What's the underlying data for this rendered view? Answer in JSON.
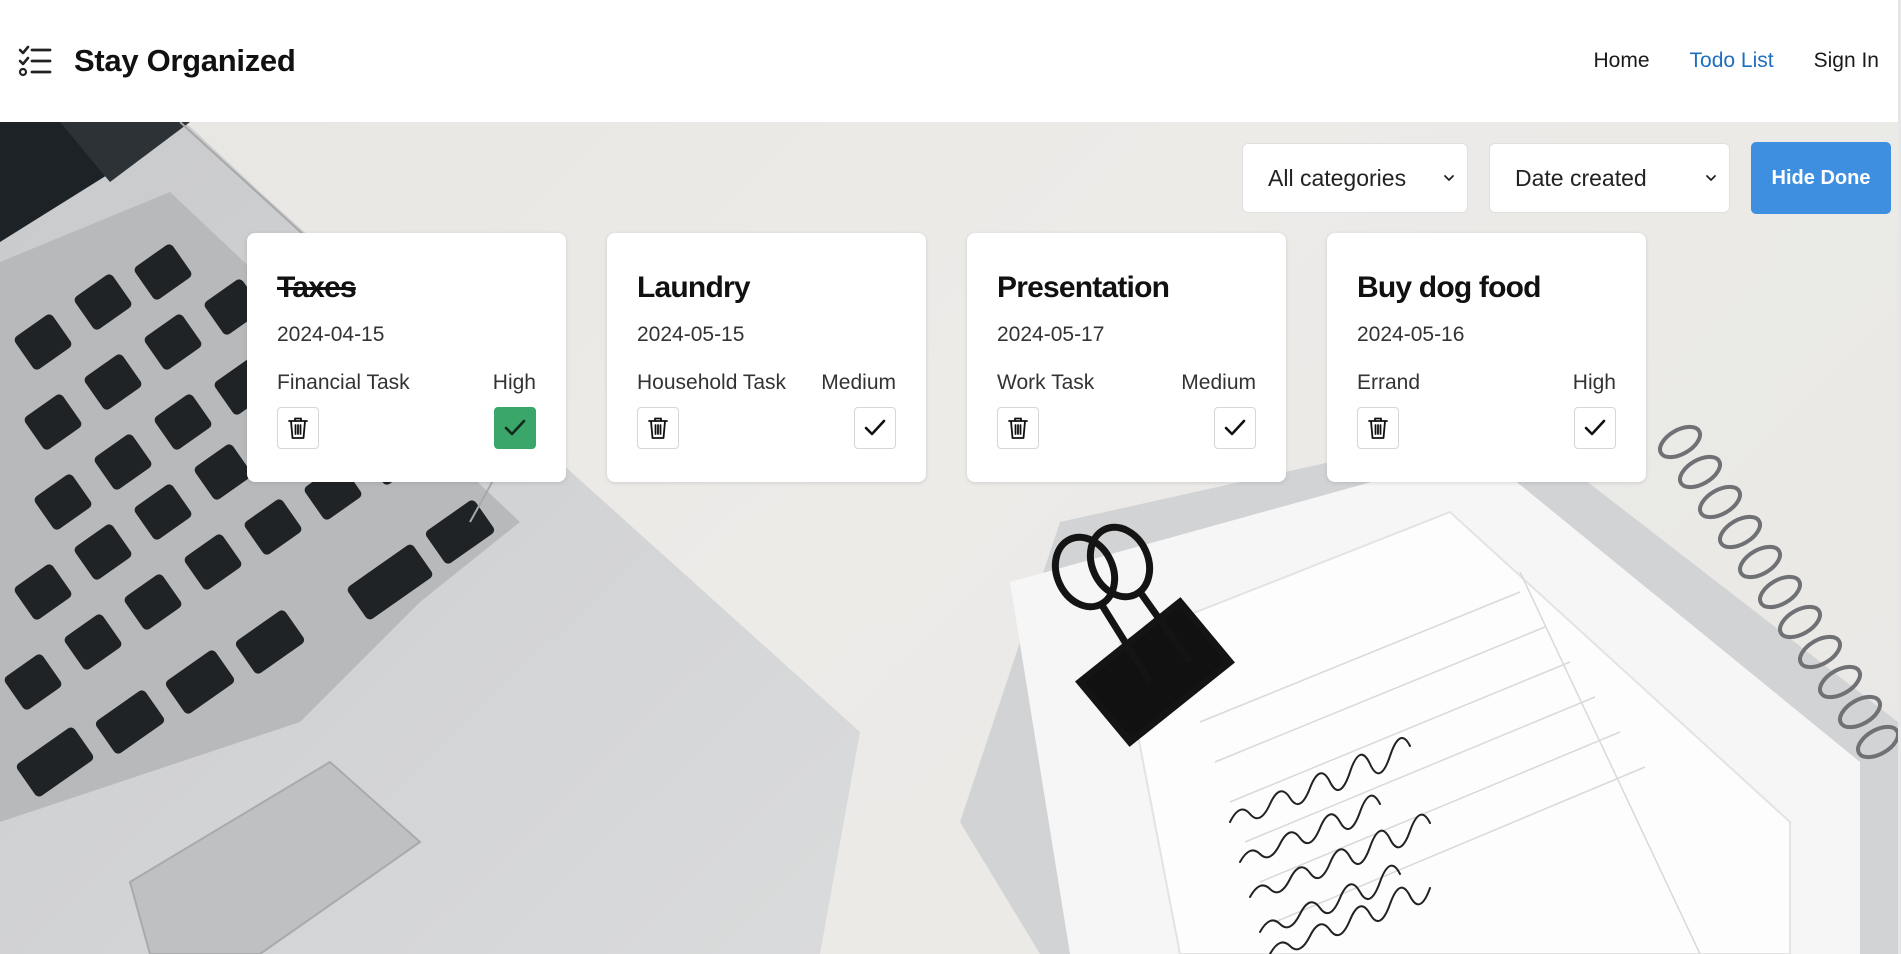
{
  "header": {
    "title": "Stay Organized",
    "nav": [
      {
        "label": "Home",
        "active": false
      },
      {
        "label": "Todo List",
        "active": true
      },
      {
        "label": "Sign In",
        "active": false
      }
    ]
  },
  "toolbar": {
    "category_filter": "All categories",
    "sort": "Date created",
    "hide_done_label": "Hide Done"
  },
  "todos": [
    {
      "title": "Taxes",
      "date": "2024-04-15",
      "category": "Financial Task",
      "priority": "High",
      "done": true
    },
    {
      "title": "Laundry",
      "date": "2024-05-15",
      "category": "Household Task",
      "priority": "Medium",
      "done": false
    },
    {
      "title": "Presentation",
      "date": "2024-05-17",
      "category": "Work Task",
      "priority": "Medium",
      "done": false
    },
    {
      "title": "Buy dog food",
      "date": "2024-05-16",
      "category": "Errand",
      "priority": "High",
      "done": false
    }
  ],
  "colors": {
    "accent": "#3e8fe0",
    "active_nav": "#1f6fbf",
    "done_green": "#3aa66a"
  },
  "icons": [
    "list-check-icon",
    "chevron-down-icon",
    "trash-icon",
    "check-icon"
  ]
}
